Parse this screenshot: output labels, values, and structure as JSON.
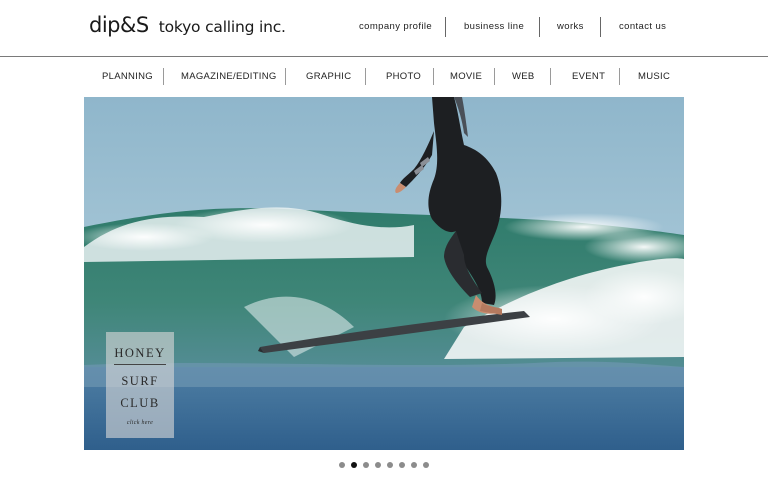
{
  "brand": {
    "mark": "dip&S",
    "name": "tokyo calling inc."
  },
  "top_nav": [
    {
      "label": "company profile"
    },
    {
      "label": "business line"
    },
    {
      "label": "works"
    },
    {
      "label": "contact us"
    }
  ],
  "category_nav": [
    {
      "label": "PLANNING"
    },
    {
      "label": "MAGAZINE/EDITING"
    },
    {
      "label": "GRAPHIC"
    },
    {
      "label": "PHOTO"
    },
    {
      "label": "MOVIE"
    },
    {
      "label": "WEB"
    },
    {
      "label": "EVENT"
    },
    {
      "label": "MUSIC"
    }
  ],
  "hero": {
    "description_icon": "surfer-photo",
    "badge": {
      "line1": "HONEY",
      "line2": "SURF",
      "line3": "CLUB",
      "cta": "click here"
    }
  },
  "slider": {
    "count": 8,
    "active_index": 1
  },
  "colors": {
    "text": "#222222",
    "divider": "#7a7a7a",
    "dot_inactive": "#8c8c8c",
    "dot_active": "#111111"
  }
}
